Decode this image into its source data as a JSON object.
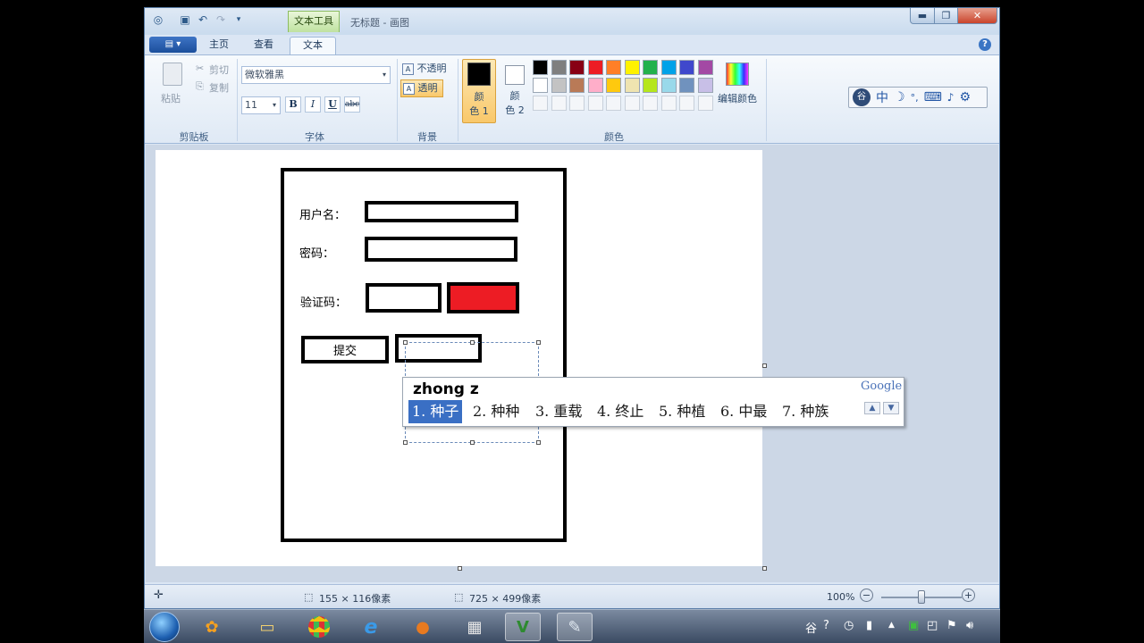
{
  "window": {
    "context_tab": "文本工具",
    "title": "无标题 - 画图",
    "caption_min": "▬",
    "caption_max": "❐",
    "caption_close": "✕"
  },
  "tabs": {
    "app_button": "▤ ▾",
    "home": "主页",
    "view": "查看",
    "text": "文本",
    "help": "?"
  },
  "clipboard": {
    "paste": "粘贴",
    "cut": "剪切",
    "copy": "复制",
    "group_label": "剪贴板"
  },
  "font": {
    "family": "微软雅黑",
    "size": "11",
    "bold": "B",
    "italic": "I",
    "underline": "U",
    "strike": "abc",
    "group_label": "字体"
  },
  "background": {
    "opaque": "不透明",
    "transparent": "透明",
    "group_label": "背景"
  },
  "colors": {
    "color1_label_a": "颜",
    "color1_label_b": "色 1",
    "color2_label_a": "颜",
    "color2_label_b": "色 2",
    "edit_colors": "编辑颜色",
    "group_label": "颜色",
    "color1_value": "#000000",
    "color2_value": "#ffffff",
    "palette_row1": [
      "#000000",
      "#7f7f7f",
      "#880015",
      "#ed1c24",
      "#ff7f27",
      "#fff200",
      "#22b14c",
      "#00a2e8",
      "#3f48cc",
      "#a349a4"
    ],
    "palette_row2": [
      "#ffffff",
      "#c3c3c3",
      "#b97a57",
      "#ffaec9",
      "#ffc90e",
      "#efe4b0",
      "#b5e61d",
      "#99d9ea",
      "#7092be",
      "#c8bfe7"
    ]
  },
  "ime_bar": {
    "mode": "中",
    "punct": "☽",
    "degree": "°,",
    "keyboard": "⌨",
    "mic": "🎤",
    "settings": "⚙"
  },
  "form": {
    "username_label": "用户名：",
    "password_label": "密码：",
    "captcha_label": "验证码：",
    "submit_label": "提交",
    "captcha_color": "#ed1c24"
  },
  "ime_popup": {
    "composition": "zhong z",
    "logo": "Google",
    "candidates": [
      "1. 种子",
      "2. 种种",
      "3. 重载",
      "4. 终止",
      "5. 种植",
      "6. 中最",
      "7. 种族"
    ],
    "page_up": "▲",
    "page_down": "▼"
  },
  "status": {
    "selection": "155 × 116像素",
    "canvas_size": "725 × 499像素",
    "zoom": "100%",
    "zoom_level": 0.5
  },
  "taskbar": {
    "apps": [
      "start",
      "app-360",
      "explorer",
      "chrome",
      "ie",
      "firefox",
      "tool",
      "vim",
      "paint"
    ],
    "tray_icons": [
      "ime-icon",
      "help-icon",
      "battery-icon",
      "arrow-up-icon",
      "360-icon",
      "flag-icon",
      "volume-icon"
    ]
  }
}
